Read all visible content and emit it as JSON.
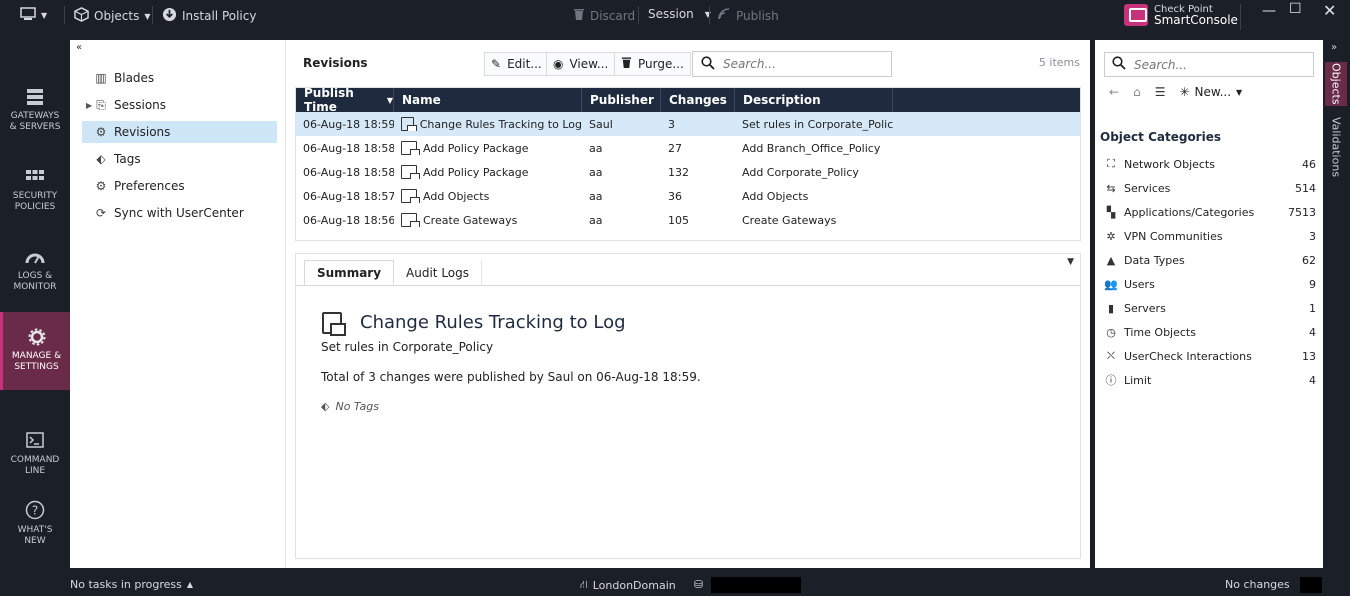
{
  "topbar": {
    "objects_label": "Objects",
    "install_policy_label": "Install Policy",
    "discard_label": "Discard",
    "session_label": "Session",
    "publish_label": "Publish",
    "brand_line1": "Check Point",
    "brand_line2": "SmartConsole"
  },
  "leftnav": {
    "items": [
      {
        "line1": "GATEWAYS",
        "line2": "& SERVERS"
      },
      {
        "line1": "SECURITY",
        "line2": "POLICIES"
      },
      {
        "line1": "LOGS &",
        "line2": "MONITOR"
      },
      {
        "line1": "MANAGE &",
        "line2": "SETTINGS"
      },
      {
        "line1": "COMMAND",
        "line2": "LINE"
      },
      {
        "line1": "WHAT'S",
        "line2": "NEW"
      }
    ]
  },
  "tree": {
    "items": [
      {
        "label": "Blades"
      },
      {
        "label": "Sessions"
      },
      {
        "label": "Revisions"
      },
      {
        "label": "Tags"
      },
      {
        "label": "Preferences"
      },
      {
        "label": "Sync with UserCenter"
      }
    ]
  },
  "revisions": {
    "title": "Revisions",
    "edit_label": "Edit...",
    "view_label": "View...",
    "purge_label": "Purge...",
    "search_placeholder": "Search...",
    "items_count": "5 items",
    "columns": [
      "Publish Time",
      "Name",
      "Publisher",
      "Changes",
      "Description"
    ],
    "rows": [
      {
        "time": "06-Aug-18 18:59",
        "name": "Change Rules Tracking to Log",
        "publisher": "Saul",
        "changes": "3",
        "description": "Set rules in Corporate_Policy"
      },
      {
        "time": "06-Aug-18 18:58",
        "name": "Add Policy Package",
        "publisher": "aa",
        "changes": "27",
        "description": "Add Branch_Office_Policy"
      },
      {
        "time": "06-Aug-18 18:58",
        "name": "Add Policy Package",
        "publisher": "aa",
        "changes": "132",
        "description": "Add Corporate_Policy"
      },
      {
        "time": "06-Aug-18 18:57",
        "name": "Add Objects",
        "publisher": "aa",
        "changes": "36",
        "description": "Add Objects"
      },
      {
        "time": "06-Aug-18 18:56",
        "name": "Create Gateways",
        "publisher": "aa",
        "changes": "105",
        "description": "Create Gateways"
      }
    ]
  },
  "detail": {
    "tab_summary": "Summary",
    "tab_audit": "Audit Logs",
    "title": "Change Rules Tracking to Log",
    "description": "Set rules in Corporate_Policy",
    "summary": "Total of 3 changes were published by Saul on 06-Aug-18 18:59.",
    "tags": "No Tags"
  },
  "rightpanel": {
    "search_placeholder": "Search...",
    "new_label": "New...",
    "categories_title": "Object Categories",
    "categories": [
      {
        "name": "Network Objects",
        "count": "46"
      },
      {
        "name": "Services",
        "count": "514"
      },
      {
        "name": "Applications/Categories",
        "count": "7513"
      },
      {
        "name": "VPN Communities",
        "count": "3"
      },
      {
        "name": "Data Types",
        "count": "62"
      },
      {
        "name": "Users",
        "count": "9"
      },
      {
        "name": "Servers",
        "count": "1"
      },
      {
        "name": "Time Objects",
        "count": "4"
      },
      {
        "name": "UserCheck Interactions",
        "count": "13"
      },
      {
        "name": "Limit",
        "count": "4"
      }
    ]
  },
  "rstrip": {
    "objects_tab": "Objects",
    "validations_tab": "Validations"
  },
  "statusbar": {
    "tasks": "No tasks in progress",
    "domain": "LondonDomain",
    "changes": "No changes"
  },
  "colors": {
    "accent": "#c8327a",
    "header": "#1e2b3f",
    "selection": "#d6e9f8"
  }
}
